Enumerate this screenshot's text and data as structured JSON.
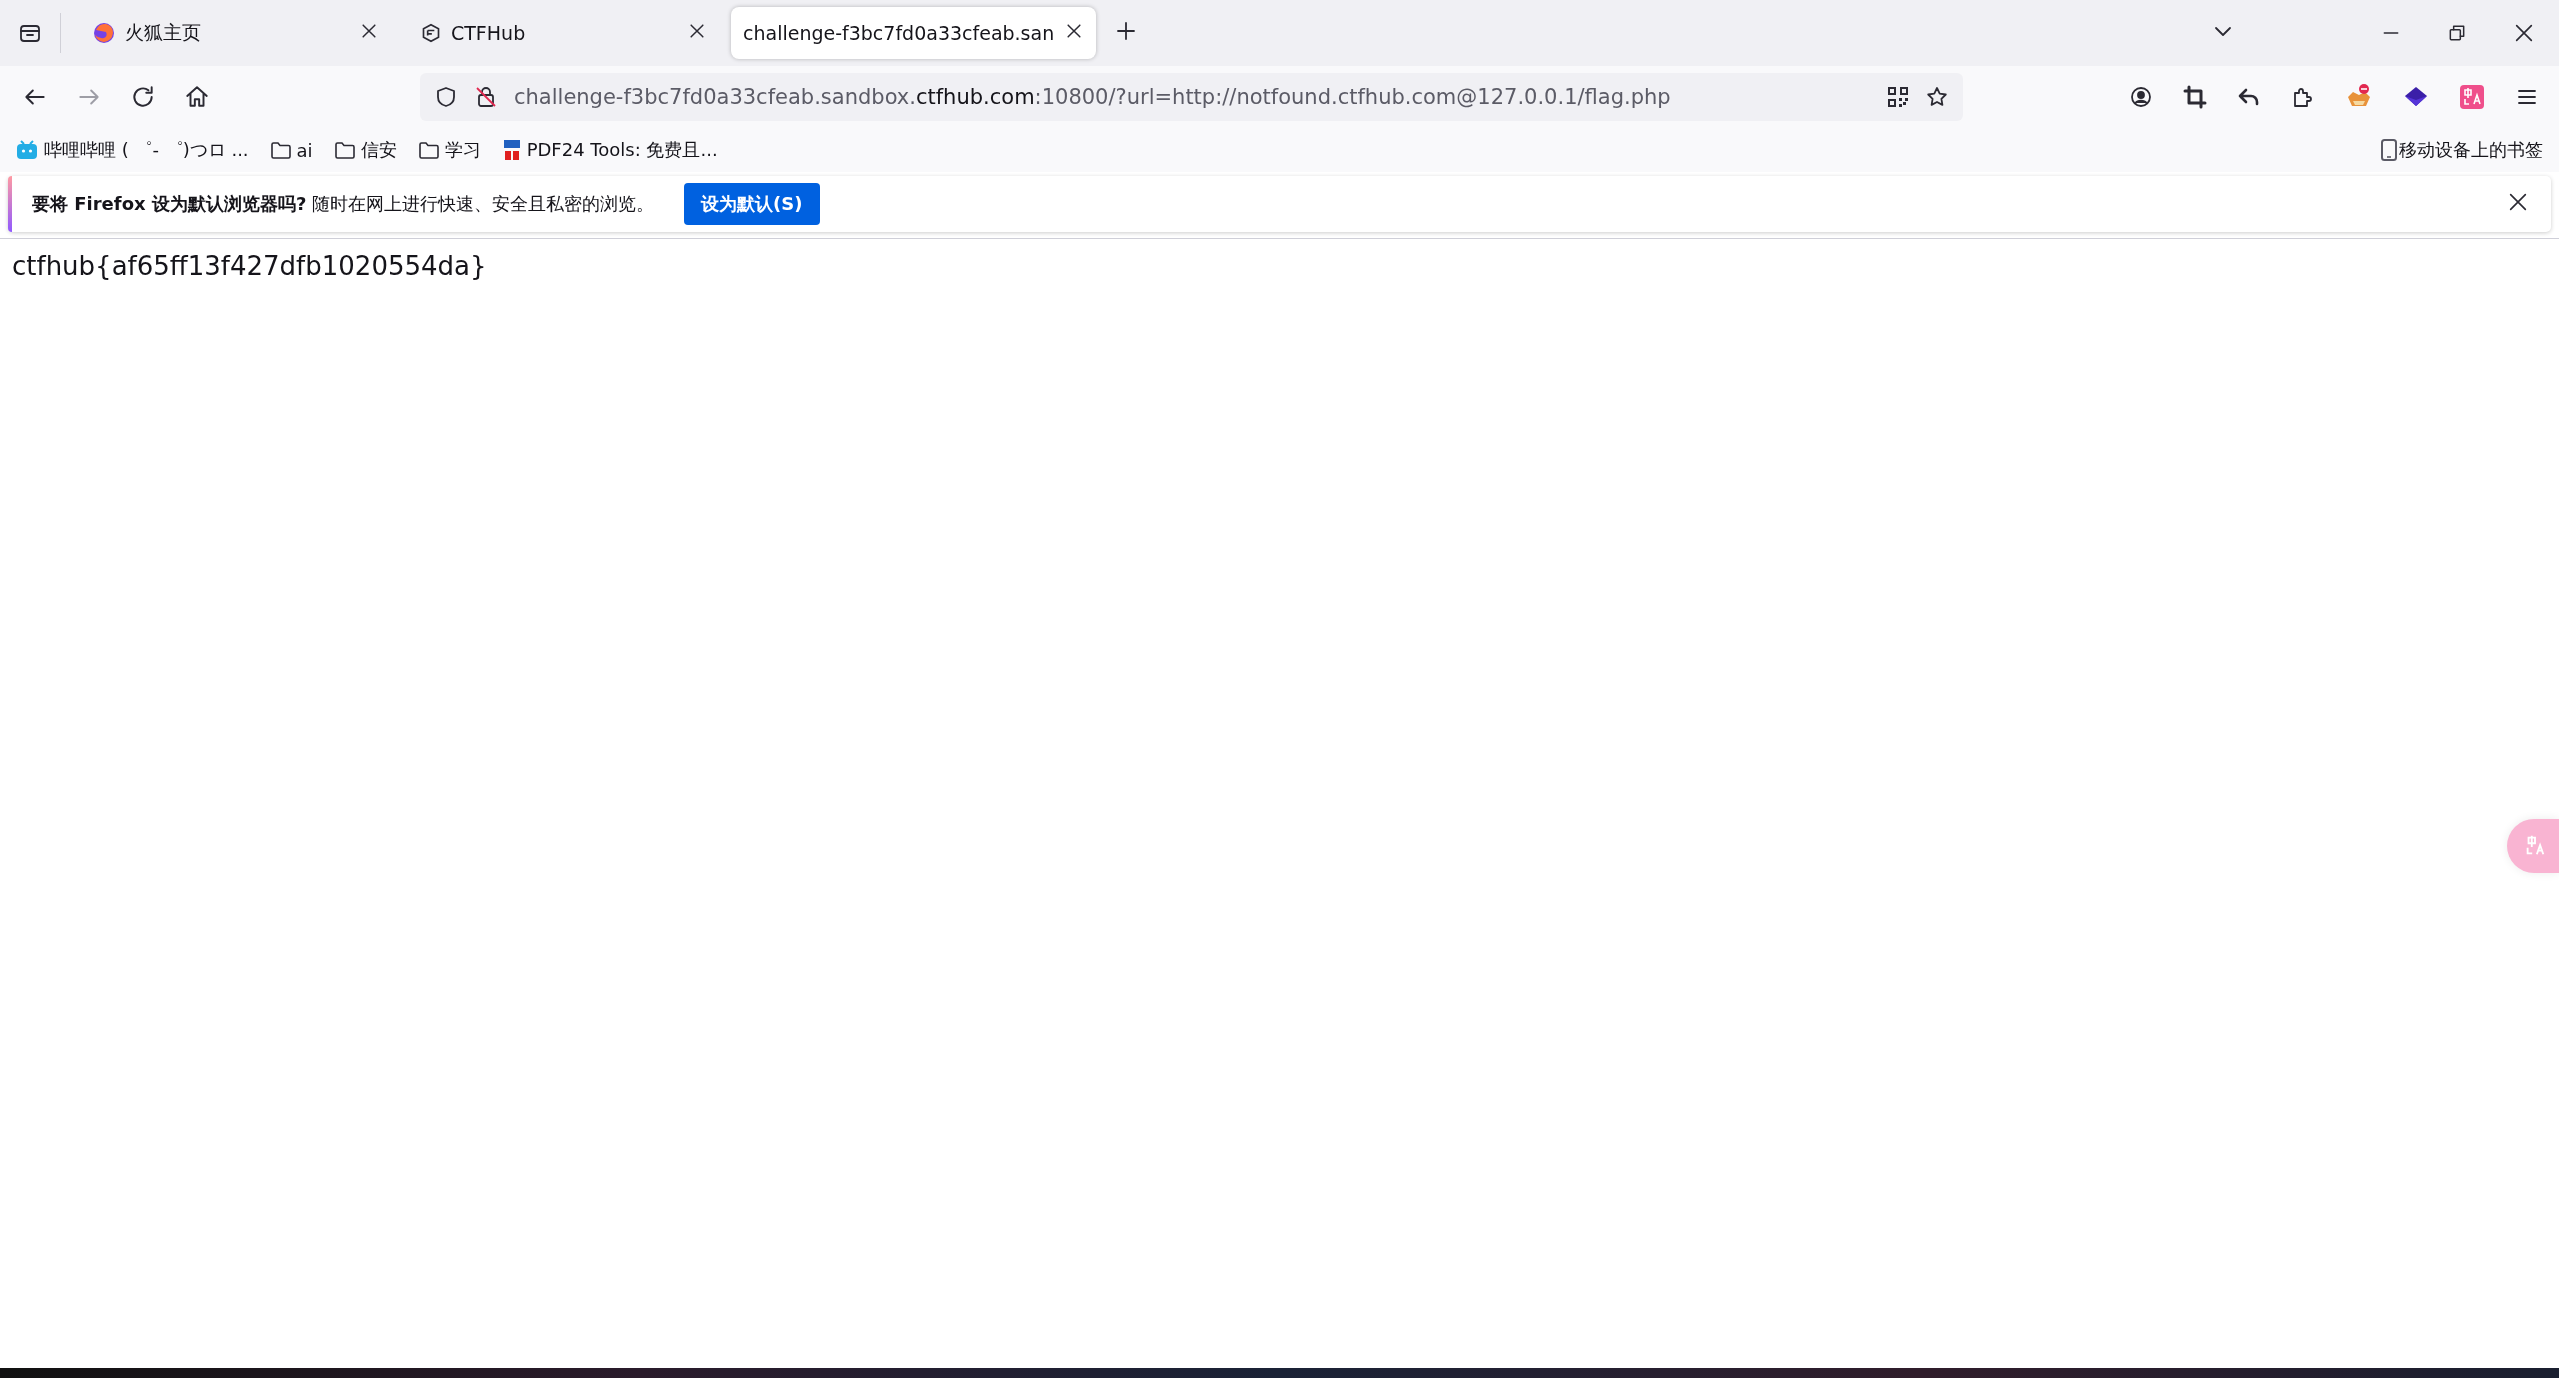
{
  "tabs": [
    {
      "label": "火狐主页",
      "kind": "firefox",
      "selected": false
    },
    {
      "label": "CTFHub",
      "kind": "hexagon",
      "selected": false
    },
    {
      "label": "challenge-f3bc7fd0a33cfeab.san",
      "kind": "plain",
      "selected": true
    }
  ],
  "address_bar": {
    "url_prefix": "challenge-f3bc7fd0a33cfeab.sandbox.",
    "url_domain": "ctfhub.com",
    "url_suffix": ":10800/?url=http://notfound.ctfhub.com@127.0.0.1/flag.php"
  },
  "bookmarks": [
    {
      "label": "哔哩哔哩 ( ゜- ゜)つロ ...",
      "kind": "tv"
    },
    {
      "label": "ai",
      "kind": "folder"
    },
    {
      "label": "信安",
      "kind": "folder"
    },
    {
      "label": "学习",
      "kind": "folder"
    },
    {
      "label": "PDF24 Tools: 免费且...",
      "kind": "pdf"
    }
  ],
  "mobile_bookmarks": "移动设备上的书签",
  "notification": {
    "message": "**要将 Firefox 设为默认浏览器吗?** 随时在网上进行快速、安全且私密的浏览。",
    "button": "设为默认(S)"
  },
  "page": {
    "text": "ctfhub{af65ff13f427dfb1020554da}"
  }
}
